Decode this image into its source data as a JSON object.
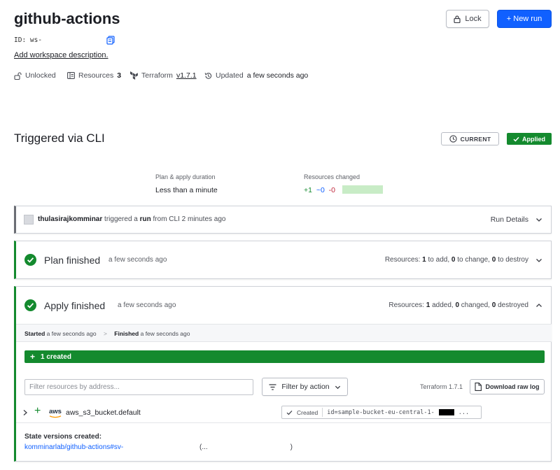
{
  "workspace": {
    "title": "github-actions",
    "id_label": "ID:",
    "id_value": "ws-",
    "description_link": "Add workspace description."
  },
  "header_buttons": {
    "lock_label": "Lock",
    "new_run_label": "+ New run"
  },
  "meta": {
    "lock_status": "Unlocked",
    "resources_label": "Resources",
    "resources_count": "3",
    "terraform_label": "Terraform",
    "terraform_version": "v1.7.1",
    "updated_label": "Updated",
    "updated_value": "a few seconds ago"
  },
  "run": {
    "title": "Triggered via CLI",
    "current_badge": "CURRENT",
    "status_badge": "Applied",
    "duration_label": "Plan & apply duration",
    "duration_value": "Less than a minute",
    "resources_changed_label": "Resources changed",
    "changes": {
      "add": "+1",
      "change": "~0",
      "destroy": "-0"
    }
  },
  "trigger_card": {
    "user": "thulasirajkomminar",
    "text_1": "triggered a",
    "run_word": "run",
    "text_2": "from CLI 2 minutes ago",
    "details_label": "Run Details"
  },
  "plan_card": {
    "title": "Plan finished",
    "time": "a few seconds ago",
    "summary_prefix": "Resources:",
    "to_add": "1",
    "to_add_label": "to add,",
    "to_change": "0",
    "to_change_label": "to change,",
    "to_destroy": "0",
    "to_destroy_label": "to destroy"
  },
  "apply_card": {
    "title": "Apply finished",
    "time": "a few seconds ago",
    "summary_prefix": "Resources:",
    "added": "1",
    "added_label": "added,",
    "changed": "0",
    "changed_label": "changed,",
    "destroyed": "0",
    "destroyed_label": "destroyed",
    "started_label": "Started",
    "started_value": "a few seconds ago",
    "finished_label": "Finished",
    "finished_value": "a few seconds ago",
    "created_bar": "1 created",
    "filter_placeholder": "Filter resources by address...",
    "filter_button": "Filter by action",
    "terraform_version": "Terraform 1.7.1",
    "download_button": "Download raw log",
    "resource": {
      "provider": "aws",
      "name": "aws_s3_bucket.default",
      "status": "Created",
      "id_text": "id=sample-bucket-eu-central-1-",
      "ellipsis": "..."
    },
    "state_versions_label": "State versions created:",
    "state_link": "komminarlab/github-actions#sv-",
    "state_paren_open": "(...",
    "state_paren_close": ")"
  },
  "colors": {
    "primary": "#1060ff",
    "success": "#148a2e",
    "destroy": "#c0283c"
  }
}
